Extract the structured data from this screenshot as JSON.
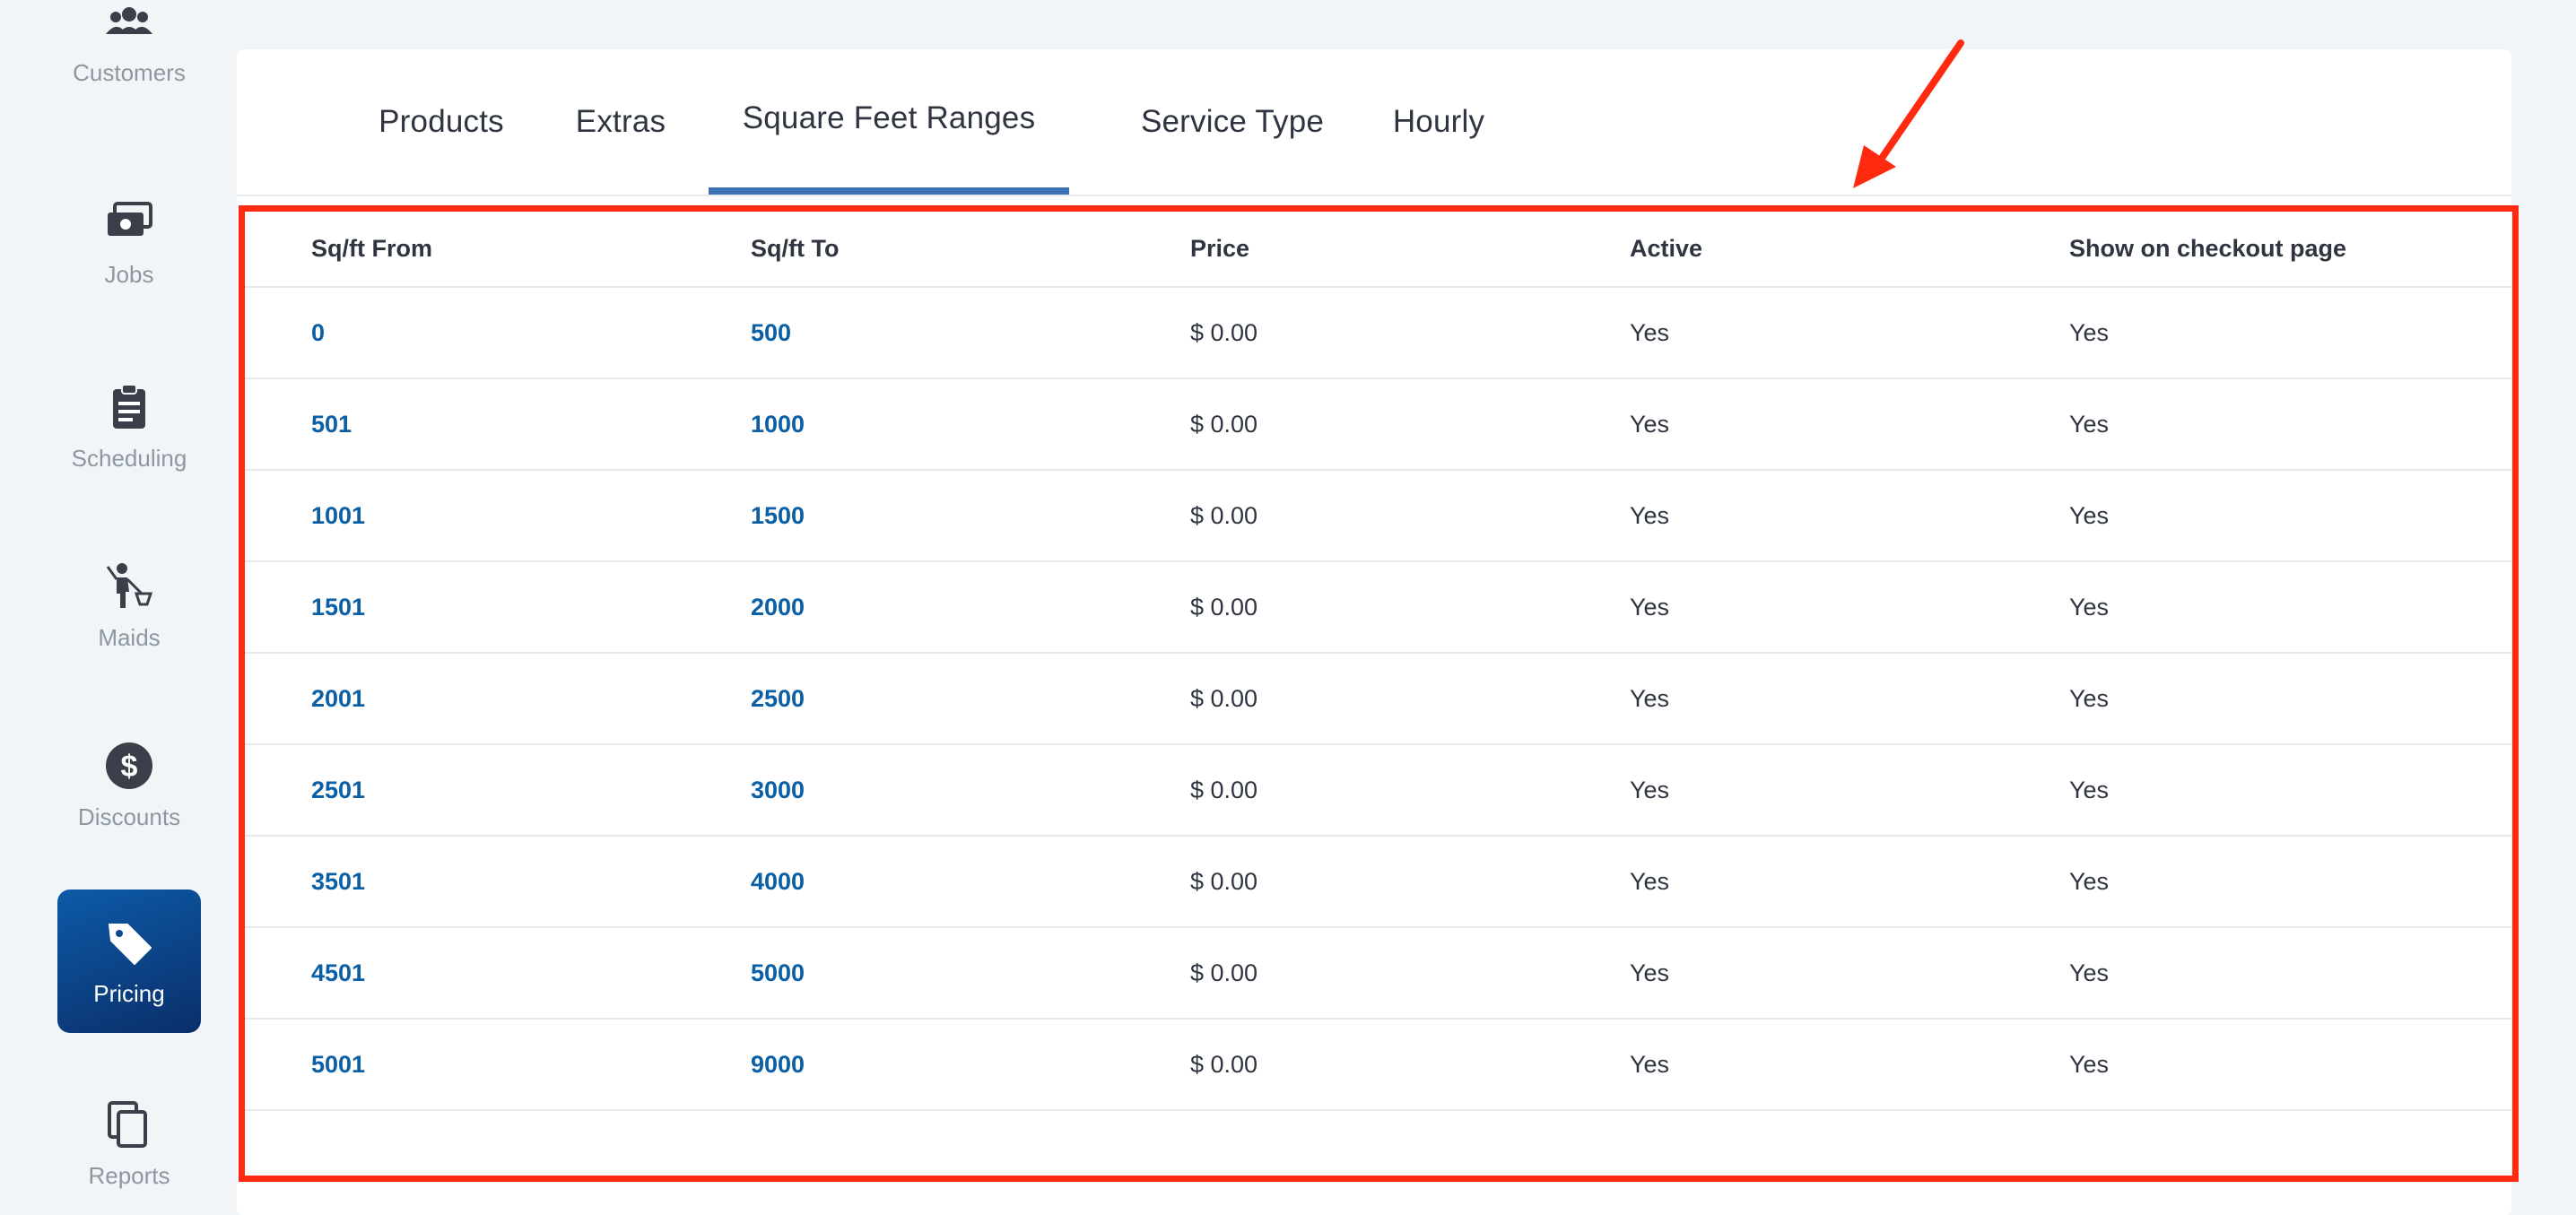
{
  "sidebar": {
    "items": [
      {
        "label": "Customers",
        "icon": "customers-icon"
      },
      {
        "label": "Jobs",
        "icon": "jobs-icon"
      },
      {
        "label": "Scheduling",
        "icon": "clipboard-icon"
      },
      {
        "label": "Maids",
        "icon": "maid-icon"
      },
      {
        "label": "Discounts",
        "icon": "dollar-icon"
      },
      {
        "label": "Pricing",
        "icon": "tag-icon",
        "active": true
      },
      {
        "label": "Reports",
        "icon": "copy-icon"
      }
    ]
  },
  "tabs": [
    {
      "label": "Products"
    },
    {
      "label": "Extras"
    },
    {
      "label": "Square Feet Ranges",
      "active": true
    },
    {
      "label": "Service Type"
    },
    {
      "label": "Hourly"
    }
  ],
  "table": {
    "headers": [
      "Sq/ft From",
      "Sq/ft To",
      "Price",
      "Active",
      "Show on checkout page"
    ],
    "rows": [
      {
        "from": "0",
        "to": "500",
        "price": "$ 0.00",
        "active": "Yes",
        "checkout": "Yes"
      },
      {
        "from": "501",
        "to": "1000",
        "price": "$ 0.00",
        "active": "Yes",
        "checkout": "Yes"
      },
      {
        "from": "1001",
        "to": "1500",
        "price": "$ 0.00",
        "active": "Yes",
        "checkout": "Yes"
      },
      {
        "from": "1501",
        "to": "2000",
        "price": "$ 0.00",
        "active": "Yes",
        "checkout": "Yes"
      },
      {
        "from": "2001",
        "to": "2500",
        "price": "$ 0.00",
        "active": "Yes",
        "checkout": "Yes"
      },
      {
        "from": "2501",
        "to": "3000",
        "price": "$ 0.00",
        "active": "Yes",
        "checkout": "Yes"
      },
      {
        "from": "3501",
        "to": "4000",
        "price": "$ 0.00",
        "active": "Yes",
        "checkout": "Yes"
      },
      {
        "from": "4501",
        "to": "5000",
        "price": "$ 0.00",
        "active": "Yes",
        "checkout": "Yes"
      },
      {
        "from": "5001",
        "to": "9000",
        "price": "$ 0.00",
        "active": "Yes",
        "checkout": "Yes"
      }
    ]
  },
  "colors": {
    "accent": "#3b6fb6",
    "link": "#0b5fa5",
    "highlight": "#ff2a0f",
    "active_nav": "#0a3f80"
  }
}
